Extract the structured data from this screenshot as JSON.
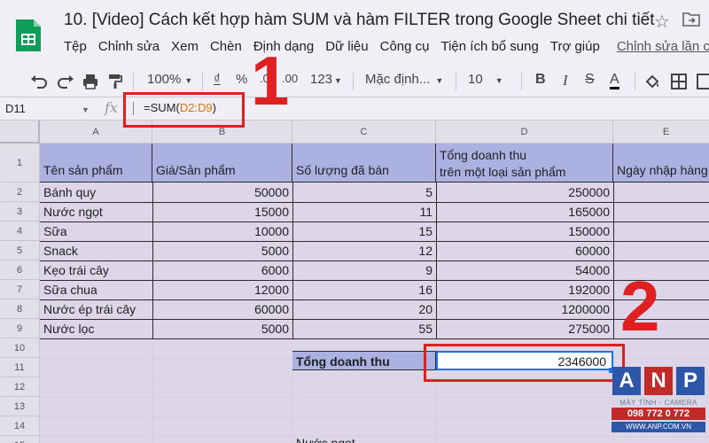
{
  "header": {
    "title": "10. [Video] Cách kết hợp hàm SUM và hàm FILTER trong Google Sheet chi tiết",
    "menu": [
      "Tệp",
      "Chỉnh sửa",
      "Xem",
      "Chèn",
      "Định dạng",
      "Dữ liệu",
      "Công cụ",
      "Tiện ích bổ sung",
      "Trợ giúp"
    ],
    "last_edit": "Chỉnh sửa lần cuối"
  },
  "toolbar": {
    "zoom": "100%",
    "currency": "₫",
    "percent": "%",
    "decimal_decrease": ".0",
    "decimal_increase": ".00",
    "more_formats": "123",
    "font": "Mặc định...",
    "font_size": "10",
    "bold": "B",
    "italic": "I",
    "strike": "S",
    "text_color": "A"
  },
  "formula_bar": {
    "cell_ref": "D11",
    "fx": "fx",
    "formula_prefix": "=SUM(",
    "formula_range": "D2:D9",
    "formula_suffix": ")"
  },
  "sheet": {
    "columns": [
      "A",
      "B",
      "C",
      "D",
      "E"
    ],
    "rows": [
      "1",
      "2",
      "3",
      "4",
      "5",
      "6",
      "7",
      "8",
      "9",
      "10",
      "11",
      "12",
      "13",
      "14",
      "15"
    ],
    "headers": {
      "a": "Tên sản phẩm",
      "b": "Giá/Sản phẩm",
      "c": "Số lượng đã bán",
      "d_line1": "Tổng doanh thu",
      "d_line2": "trên một loại sản phẩm",
      "e": "Ngày nhập hàng"
    },
    "data": [
      {
        "name": "Bánh quy",
        "price": "50000",
        "qty": "5",
        "revenue": "250000"
      },
      {
        "name": "Nước ngọt",
        "price": "15000",
        "qty": "11",
        "revenue": "165000"
      },
      {
        "name": "Sữa",
        "price": "10000",
        "qty": "15",
        "revenue": "150000"
      },
      {
        "name": "Snack",
        "price": "5000",
        "qty": "12",
        "revenue": "60000"
      },
      {
        "name": "Kẹo trái cây",
        "price": "6000",
        "qty": "9",
        "revenue": "54000"
      },
      {
        "name": "Sữa chua",
        "price": "12000",
        "qty": "16",
        "revenue": "192000"
      },
      {
        "name": "Nước ép trái cây",
        "price": "60000",
        "qty": "20",
        "revenue": "1200000"
      },
      {
        "name": "Nước lọc",
        "price": "5000",
        "qty": "55",
        "revenue": "275000"
      }
    ],
    "total_label": "Tổng doanh thu",
    "total_value": "2346000",
    "row15_c": "Nước ngọt"
  },
  "annotations": {
    "label1": "1",
    "label2": "2"
  },
  "watermark": {
    "letters": [
      "A",
      "N",
      "P"
    ],
    "tagline": "MÁY TÍNH - CAMERA",
    "phone": "098 772 0 772",
    "url": "WWW.ANP.COM.VN"
  },
  "colors": {
    "header_fill": "#abb1e0",
    "accent_red": "#e02020",
    "sheets_green": "#0f9d58"
  }
}
